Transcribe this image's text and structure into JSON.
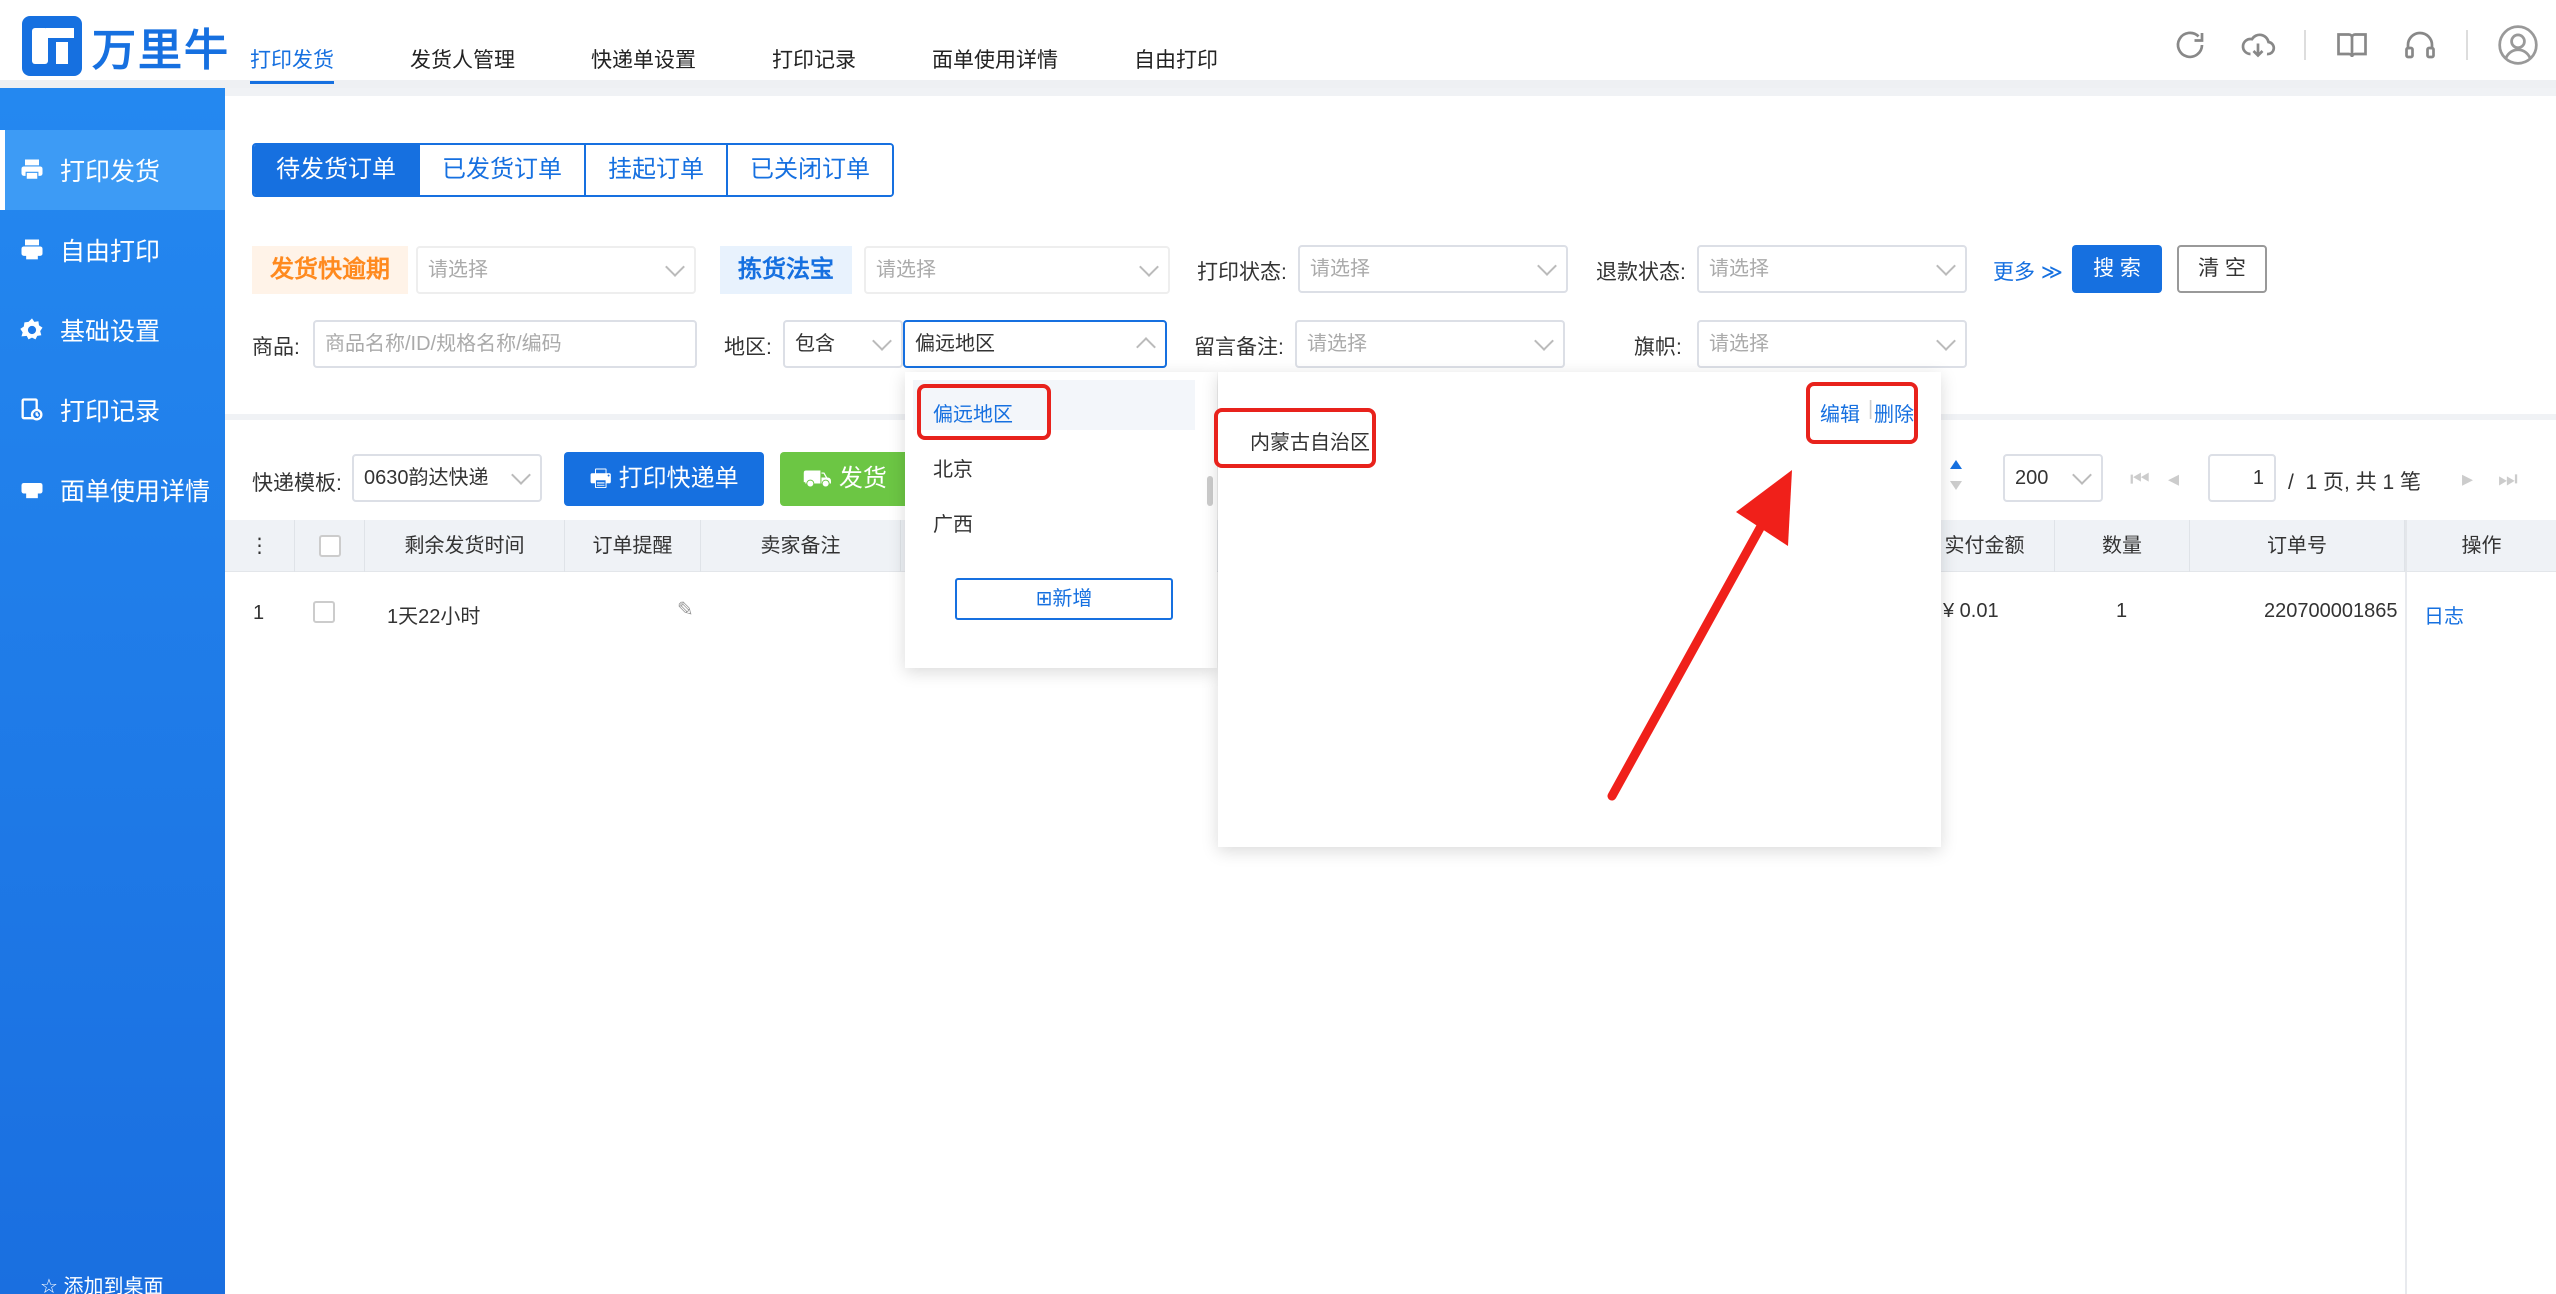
{
  "brand": {
    "name": "万里牛"
  },
  "topnav": [
    "打印发货",
    "发货人管理",
    "快递单设置",
    "打印记录",
    "面单使用详情",
    "自由打印"
  ],
  "sidebar": {
    "items": [
      "打印发货",
      "自由打印",
      "基础设置",
      "打印记录",
      "面单使用详情"
    ],
    "footer": "添加到桌面"
  },
  "order_tabs": [
    "待发货订单",
    "已发货订单",
    "挂起订单",
    "已关闭订单"
  ],
  "filters": {
    "shipping_overdue": "发货快逾期",
    "picking": "拣货法宝",
    "placeholder": "请选择",
    "print_status": "打印状态:",
    "refund_status": "退款状态:",
    "more": "更多",
    "search": "搜 索",
    "clear": "清 空",
    "product_label": "商品:",
    "product_placeholder": "商品名称/ID/规格名称/编码",
    "region_label": "地区:",
    "region_mode": "包含",
    "region_value": "偏远地区",
    "remark_label": "留言备注:",
    "flag_label": "旗帜:"
  },
  "toolbar": {
    "template_label": "快递模板:",
    "template_value": "0630韵达快递",
    "print_button": "打印快递单",
    "ship_button": "发货",
    "page_size": "200",
    "page_current": "1",
    "page_info": "/  1 页, 共 1 笔"
  },
  "region_dropdown": {
    "options": [
      "偏远地区",
      "北京",
      "广西"
    ],
    "add_button": "新增",
    "detail_item": "内蒙古自治区",
    "edit": "编辑",
    "delete": "删除"
  },
  "table": {
    "headers": [
      "剩余发货时间",
      "订单提醒",
      "卖家备注",
      "实付金额",
      "数量",
      "订单号",
      "操作"
    ],
    "rows": [
      {
        "index": "1",
        "time_left": "1天22小时",
        "amount": "¥ 0.01",
        "qty": "1",
        "order_no": "220700001865",
        "action": "日志"
      }
    ]
  },
  "colors": {
    "primary": "#1670e0",
    "annotation": "#e8221c",
    "ship_green": "#6cc644",
    "overdue_orange": "#ff8a1f"
  }
}
